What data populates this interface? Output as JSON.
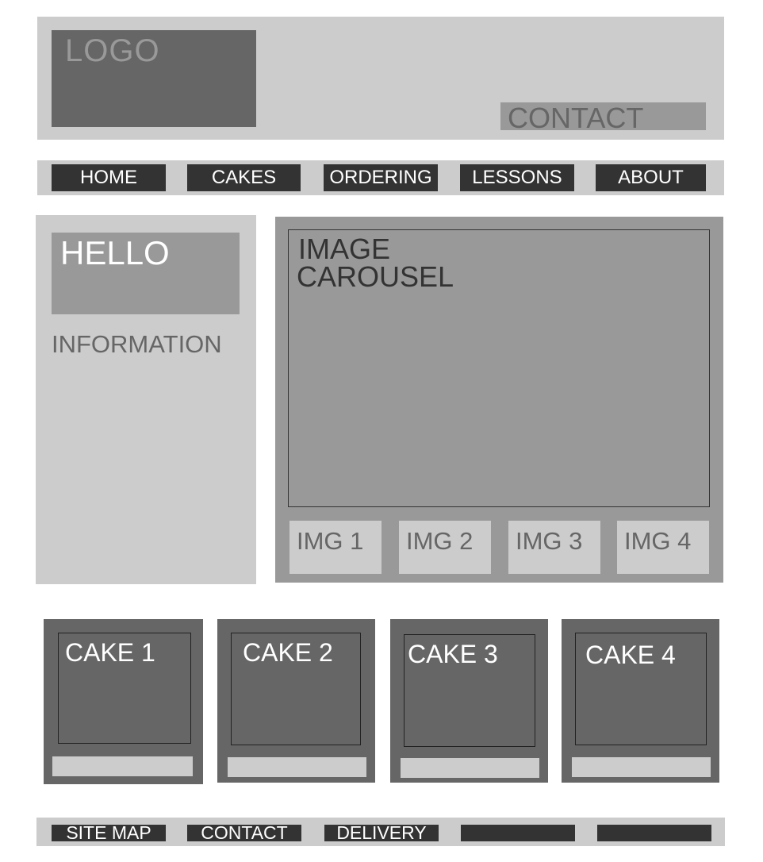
{
  "header": {
    "logo_label": "LOGO",
    "contact_label": "CONTACT"
  },
  "nav": {
    "items": [
      {
        "label": "HOME"
      },
      {
        "label": "CAKES"
      },
      {
        "label": "ORDERING"
      },
      {
        "label": "LESSONS"
      },
      {
        "label": "ABOUT"
      }
    ]
  },
  "sidebar": {
    "hello": "HELLO",
    "information": "INFORMATION"
  },
  "carousel": {
    "title_line1": "IMAGE",
    "title_line2": "CAROUSEL",
    "thumbs": [
      {
        "label": "IMG 1"
      },
      {
        "label": "IMG 2"
      },
      {
        "label": "IMG 3"
      },
      {
        "label": "IMG 4"
      }
    ]
  },
  "cakes": [
    {
      "label": "CAKE 1"
    },
    {
      "label": "CAKE 2"
    },
    {
      "label": "CAKE 3"
    },
    {
      "label": "CAKE 4"
    }
  ],
  "footer": {
    "items": [
      {
        "label": "SITE MAP"
      },
      {
        "label": "CONTACT"
      },
      {
        "label": "DELIVERY"
      },
      {
        "label": ""
      },
      {
        "label": ""
      }
    ]
  }
}
